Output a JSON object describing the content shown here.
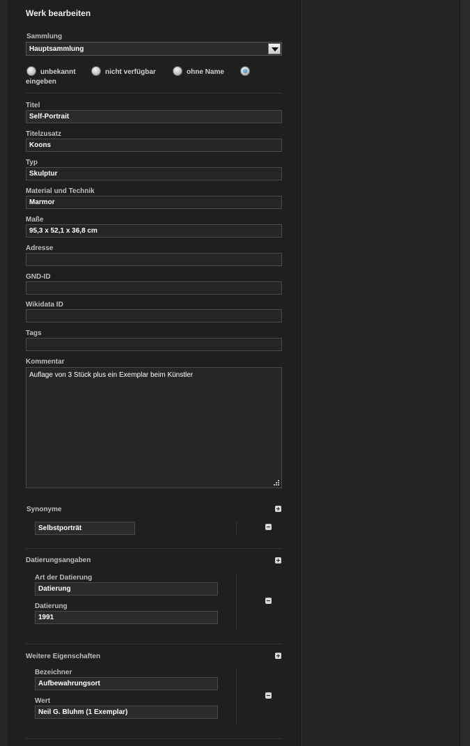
{
  "form": {
    "title": "Werk bearbeiten",
    "sammlung": {
      "label": "Sammlung",
      "value": "Hauptsammlung"
    },
    "name_options": [
      {
        "label": "unbekannt",
        "checked": false
      },
      {
        "label": "nicht verfügbar",
        "checked": false
      },
      {
        "label": "ohne Name",
        "checked": false
      },
      {
        "label": "eingeben",
        "checked": true
      }
    ],
    "fields": {
      "titel": {
        "label": "Titel",
        "value": "Self-Portrait"
      },
      "titelzusatz": {
        "label": "Titelzusatz",
        "value": "Koons"
      },
      "typ": {
        "label": "Typ",
        "value": "Skulptur"
      },
      "material": {
        "label": "Material und Technik",
        "value": "Marmor"
      },
      "masse": {
        "label": "Maße",
        "value": "95,3 x 52,1 x 36,8 cm"
      },
      "adresse": {
        "label": "Adresse",
        "value": ""
      },
      "gnd": {
        "label": "GND-ID",
        "value": ""
      },
      "wikidata": {
        "label": "Wikidata ID",
        "value": ""
      },
      "tags": {
        "label": "Tags",
        "value": ""
      },
      "kommentar": {
        "label": "Kommentar",
        "value": "Auflage von 3 Stück plus ein Exemplar beim Künstler"
      }
    },
    "synonyme": {
      "label": "Synonyme",
      "items": [
        "Selbstporträt"
      ]
    },
    "datierung": {
      "label": "Datierungsangaben",
      "art_label": "Art der Datierung",
      "art_value": "Datierung",
      "datierung_label": "Datierung",
      "datierung_value": "1991"
    },
    "eigenschaften": {
      "label": "Weitere Eigenschaften",
      "bezeichner_label": "Bezeichner",
      "bezeichner_value": "Aufbewahrungsort",
      "wert_label": "Wert",
      "wert_value": "Neil G. Bluhm (1 Exemplar)"
    }
  }
}
